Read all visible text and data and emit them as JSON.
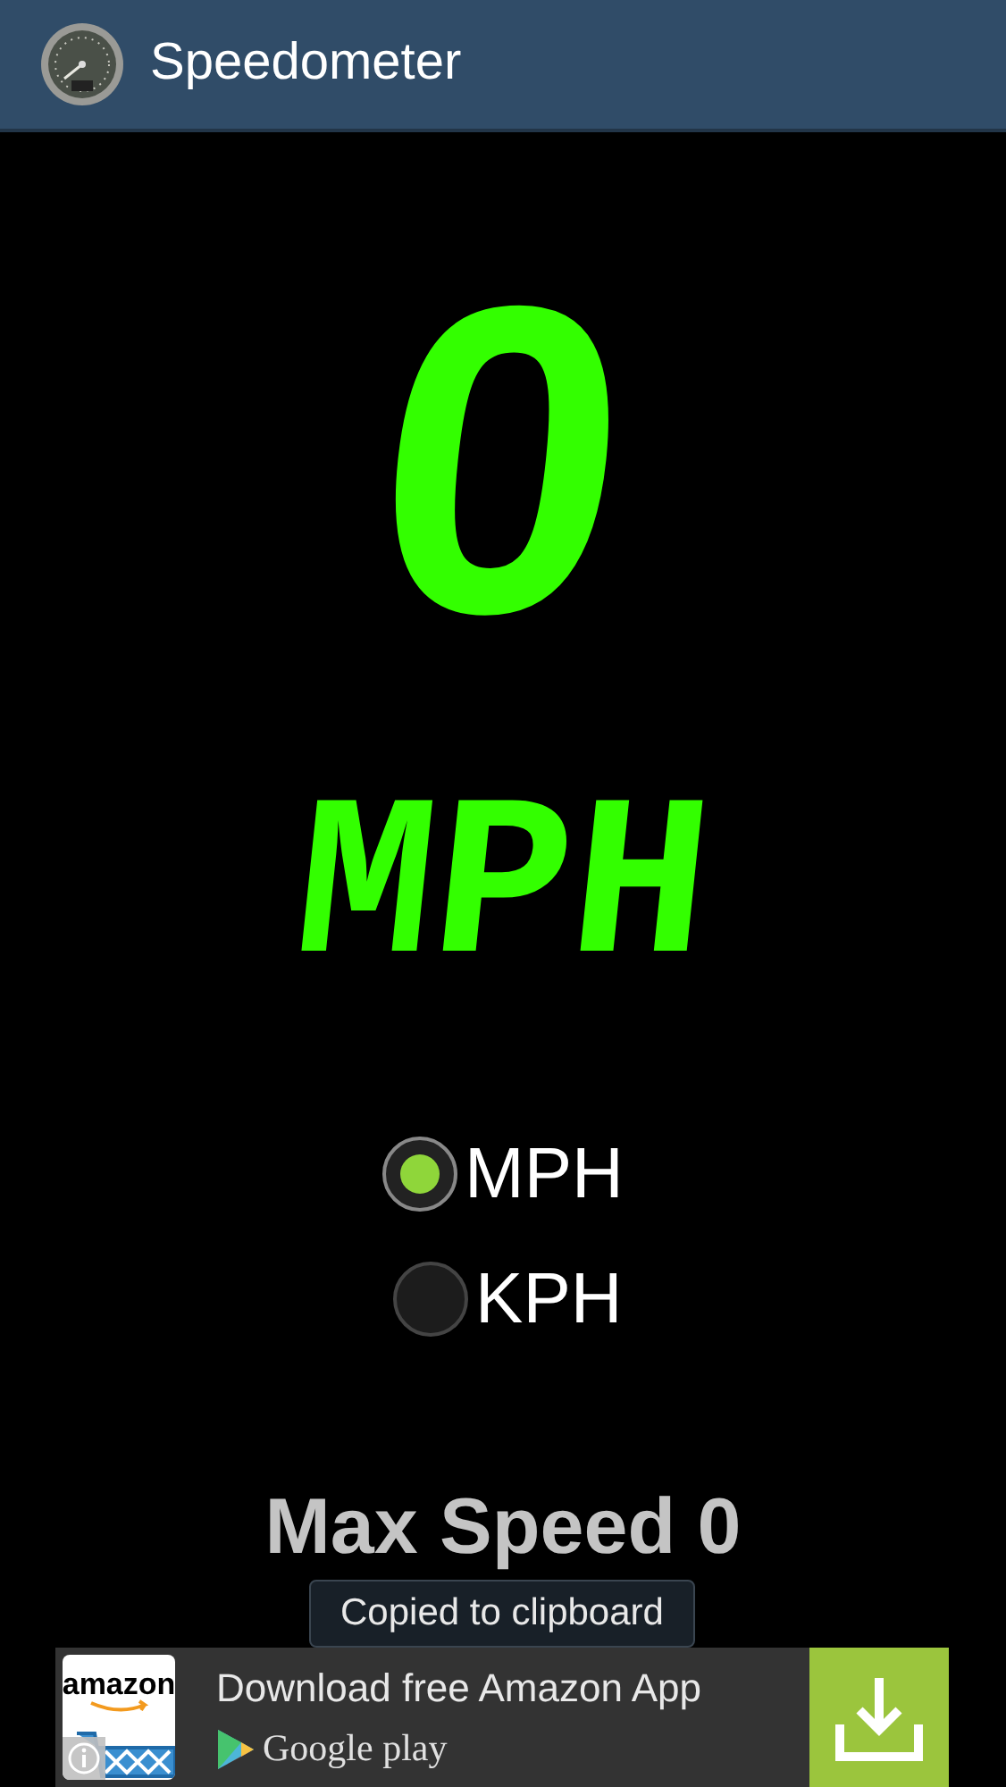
{
  "app_bar": {
    "title": "Speedometer"
  },
  "speed": {
    "value": "0",
    "unit": "MPH"
  },
  "units": [
    {
      "label": "MPH",
      "selected": true
    },
    {
      "label": "KPH",
      "selected": false
    }
  ],
  "max_speed": "Max Speed 0",
  "toast": "Copied to clipboard",
  "ad": {
    "logo": "amazon",
    "headline": "Download free Amazon App",
    "store": "Google play"
  }
}
